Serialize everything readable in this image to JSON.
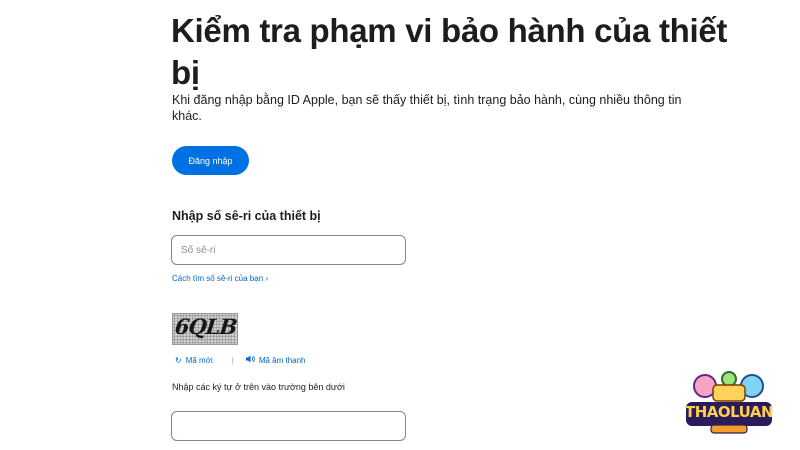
{
  "header": {
    "title": "Kiểm tra phạm vi bảo hành của thiết bị",
    "subtitle": "Khi đăng nhập bằng ID Apple, bạn sẽ thấy thiết bị, tình trạng bảo hành, cùng nhiều thông tin khác."
  },
  "signin": {
    "label": "Đăng nhập"
  },
  "serial": {
    "heading": "Nhập số sê-ri của thiết bị",
    "placeholder": "Số sê-ri",
    "value": "",
    "help_link": "Cách tìm số sê-ri của bạn ›"
  },
  "captcha": {
    "image_text": "6QLB",
    "new_code_label": "Mã mới",
    "new_code_icon": "refresh-icon",
    "audio_code_label": "Mã âm thanh",
    "audio_code_icon": "speaker-icon",
    "separator": "|",
    "hint": "Nhập các ký tự ở trên vào trường bên dưới",
    "input_value": ""
  },
  "watermark": {
    "text": "THAOLUAN",
    "icon": "thaoluan-logo"
  },
  "colors": {
    "accent": "#0071e3",
    "link": "#0066cc",
    "text": "#1d1d1f",
    "border": "#86868b"
  }
}
